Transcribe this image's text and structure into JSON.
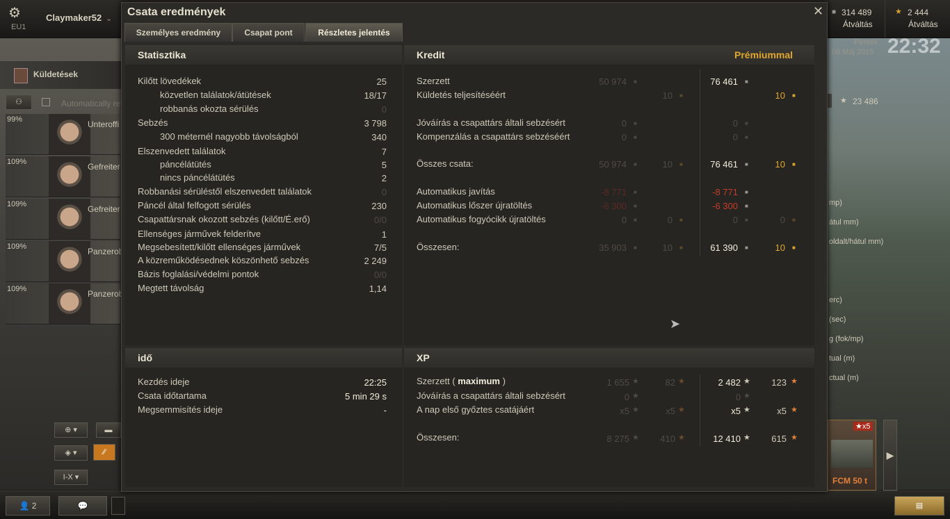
{
  "topbar": {
    "server": "EU1",
    "username": "Claymaker52",
    "credits": "314 489",
    "credits_label": "Átváltás",
    "gold": "2 444",
    "gold_label": "Átváltás",
    "day": "Péntek",
    "date": "08 Máj 2015",
    "time": "22:32"
  },
  "left": {
    "missions": "Küldetések",
    "auto_label": "Automatically re",
    "crew": [
      {
        "pct": "99%",
        "name": "Unteroffi"
      },
      {
        "pct": "109%",
        "name": "Gefreiter"
      },
      {
        "pct": "109%",
        "name": "Gefreiter"
      },
      {
        "pct": "109%",
        "name": "Panzerob"
      },
      {
        "pct": "109%",
        "name": "Panzerob"
      }
    ],
    "filter_tier": "I-X"
  },
  "right": {
    "xp_value": "23 486",
    "labels": [
      "mp)",
      "átul mm)",
      "oldalt/hátul mm)",
      "erc)",
      "(sec)",
      "g (fok/mp)",
      "tual (m)",
      "ctual (m)"
    ],
    "tank_name": "FCM 50 t",
    "tank_badge": "x5"
  },
  "bottom": {
    "friends": "2"
  },
  "dialog": {
    "title": "Csata eredmények",
    "tabs": [
      "Személyes eredmény",
      "Csapat pont",
      "Részletes jelentés"
    ],
    "stats": {
      "header": "Statisztika",
      "rows": [
        {
          "label": "Kilőtt lövedékek",
          "value": "25",
          "indent": false,
          "dim": false
        },
        {
          "label": "közvetlen találatok/átütések",
          "value": "18/17",
          "indent": true,
          "dim": false
        },
        {
          "label": "robbanás okozta sérülés",
          "value": "0",
          "indent": true,
          "dim": true
        },
        {
          "label": "Sebzés",
          "value": "3 798",
          "indent": false,
          "dim": false
        },
        {
          "label": "300 méternél nagyobb távolságból",
          "value": "340",
          "indent": true,
          "dim": false
        },
        {
          "label": "Elszenvedett találatok",
          "value": "7",
          "indent": false,
          "dim": false
        },
        {
          "label": "páncélátütés",
          "value": "5",
          "indent": true,
          "dim": false
        },
        {
          "label": "nincs páncélátütés",
          "value": "2",
          "indent": true,
          "dim": false
        },
        {
          "label": "Robbanási sérüléstől elszenvedett találatok",
          "value": "0",
          "indent": false,
          "dim": true
        },
        {
          "label": "Páncél által felfogott sérülés",
          "value": "230",
          "indent": false,
          "dim": false
        },
        {
          "label": "Csapattársnak okozott sebzés (kilőtt/É.erő)",
          "value": "0/0",
          "indent": false,
          "dim": true
        },
        {
          "label": "Ellenséges járművek felderítve",
          "value": "1",
          "indent": false,
          "dim": false
        },
        {
          "label": "Megsebesített/kilőtt ellenséges járművek",
          "value": "7/5",
          "indent": false,
          "dim": false
        },
        {
          "label": "A közreműködésednek köszönhető sebzés",
          "value": "2 249",
          "indent": false,
          "dim": false
        },
        {
          "label": "Bázis foglalási/védelmi pontok",
          "value": "0/0",
          "indent": false,
          "dim": true
        },
        {
          "label": "Megtett távolság",
          "value": "1,14",
          "indent": false,
          "dim": false
        }
      ]
    },
    "credit": {
      "header": "Kredit",
      "premium_label": "Prémiummal",
      "rows": [
        {
          "label": "Szerzett",
          "std_c": "50 974",
          "std_g": "",
          "prem_c": "76 461",
          "prem_g": "",
          "cls": "dim",
          "pcls": "bright"
        },
        {
          "label": "Küldetés teljesítéséért",
          "std_c": "",
          "std_g": "10",
          "prem_c": "",
          "prem_g": "10",
          "cls": "dim",
          "pcls": "bright"
        },
        {
          "label": "Jóváírás a csapattárs általi sebzésért",
          "std_c": "0",
          "std_g": "",
          "prem_c": "0",
          "prem_g": "",
          "cls": "dim",
          "pcls": "dim"
        },
        {
          "label": "Kompenzálás a csapattárs sebzéséért",
          "std_c": "0",
          "std_g": "",
          "prem_c": "0",
          "prem_g": "",
          "cls": "dim",
          "pcls": "dim"
        },
        {
          "label": "Összes csata:",
          "std_c": "50 974",
          "std_g": "10",
          "prem_c": "76 461",
          "prem_g": "10",
          "cls": "dim",
          "pcls": "bright"
        },
        {
          "label": "Automatikus javítás",
          "std_c": "-8 771",
          "std_g": "",
          "prem_c": "-8 771",
          "prem_g": "",
          "cls": "dimred",
          "pcls": "red"
        },
        {
          "label": "Automatikus lőszer újratöltés",
          "std_c": "-6 300",
          "std_g": "",
          "prem_c": "-6 300",
          "prem_g": "",
          "cls": "dimred",
          "pcls": "red"
        },
        {
          "label": "Automatikus fogyócikk újratöltés",
          "std_c": "0",
          "std_g": "0",
          "prem_c": "0",
          "prem_g": "0",
          "cls": "dim",
          "pcls": "dim"
        },
        {
          "label": "Összesen:",
          "std_c": "35 903",
          "std_g": "10",
          "prem_c": "61 390",
          "prem_g": "10",
          "cls": "dim",
          "pcls": "bright"
        }
      ]
    },
    "time": {
      "header": "idő",
      "rows": [
        {
          "label": "Kezdés ideje",
          "value": "22:25"
        },
        {
          "label": "Csata időtartama",
          "value": "5 min 29 s"
        },
        {
          "label": "Megsemmisítés ideje",
          "value": "-"
        }
      ]
    },
    "xp": {
      "header": "XP",
      "earned_label": "Szerzett (",
      "earned_max": "maximum",
      "earned_close": ")",
      "rows": [
        {
          "label": "",
          "std_x": "1 655",
          "std_f": "82",
          "prem_x": "2 482",
          "prem_f": "123"
        },
        {
          "label": "Jóváírás a csapattárs általi sebzésért",
          "std_x": "0",
          "std_f": "",
          "prem_x": "0",
          "prem_f": ""
        },
        {
          "label": "A nap első győztes csatájáért",
          "std_x": "x5",
          "std_f": "x5",
          "prem_x": "x5",
          "prem_f": "x5"
        },
        {
          "label": "Összesen:",
          "std_x": "8 275",
          "std_f": "410",
          "prem_x": "12 410",
          "prem_f": "615"
        }
      ]
    }
  }
}
